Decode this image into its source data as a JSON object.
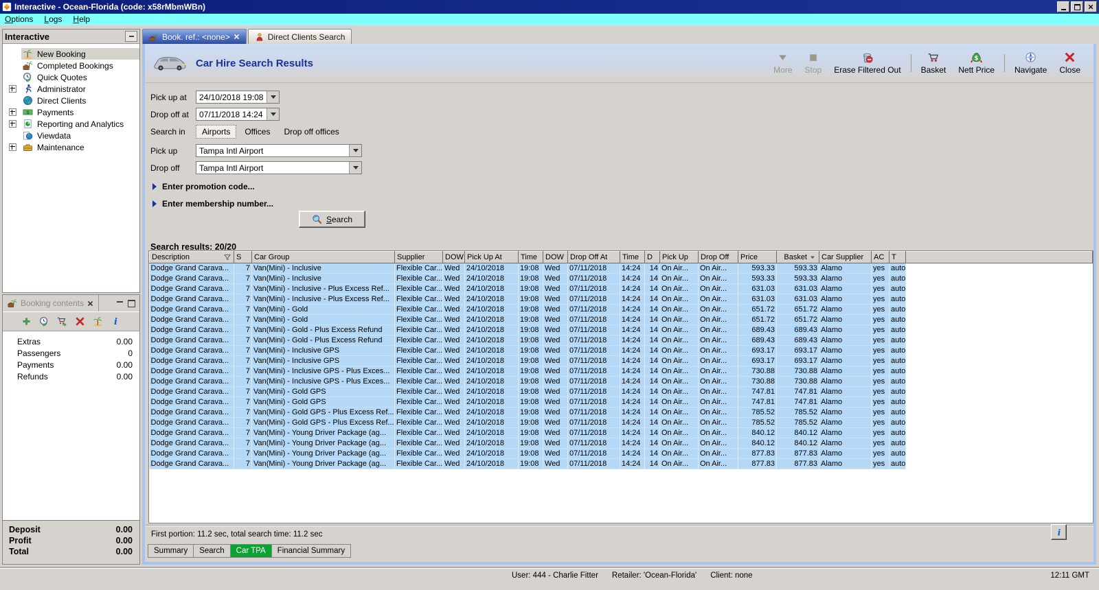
{
  "window": {
    "title": "Interactive - Ocean-Florida (code: x58rMbmWBn)",
    "menu": [
      {
        "label": "Options",
        "key": "O"
      },
      {
        "label": "Logs",
        "key": "L"
      },
      {
        "label": "Help",
        "key": "H"
      }
    ],
    "status": {
      "user": "User: 444 - Charlie Fitter",
      "retailer": "Retailer: 'Ocean-Florida'",
      "client": "Client: none",
      "time": "12:11 GMT"
    }
  },
  "sidebar": {
    "title": "Interactive",
    "items": [
      {
        "label": "New Booking",
        "icon": "palm",
        "expandable": false,
        "selected": true
      },
      {
        "label": "Completed Bookings",
        "icon": "case-palm",
        "expandable": false
      },
      {
        "label": "Quick Quotes",
        "icon": "quickquote",
        "expandable": false
      },
      {
        "label": "Administrator",
        "icon": "runner",
        "expandable": true
      },
      {
        "label": "Direct Clients",
        "icon": "globe",
        "expandable": false
      },
      {
        "label": "Payments",
        "icon": "cash",
        "expandable": true
      },
      {
        "label": "Reporting and Analytics",
        "icon": "report",
        "expandable": true
      },
      {
        "label": "Viewdata",
        "icon": "viewdata",
        "expandable": false
      },
      {
        "label": "Maintenance",
        "icon": "toolbox",
        "expandable": true
      }
    ]
  },
  "booking_contents": {
    "title": "Booking contents",
    "toolbar": [
      {
        "name": "add",
        "icon": "plus"
      },
      {
        "name": "quick-quote",
        "icon": "quickquote"
      },
      {
        "name": "move-to-basket",
        "icon": "cart-add"
      },
      {
        "name": "delete",
        "icon": "x",
        "red": true
      },
      {
        "name": "new-booking",
        "icon": "palm"
      },
      {
        "name": "info",
        "icon": "info"
      }
    ],
    "rows": [
      {
        "label": "Extras",
        "value": "0.00"
      },
      {
        "label": "Passengers",
        "value": "0"
      },
      {
        "label": "Payments",
        "value": "0.00"
      },
      {
        "label": "Refunds",
        "value": "0.00"
      }
    ],
    "totals": [
      {
        "label": "Deposit",
        "value": "0.00"
      },
      {
        "label": "Profit",
        "value": "0.00"
      },
      {
        "label": "Total",
        "value": "0.00"
      }
    ]
  },
  "main": {
    "tabs": [
      {
        "label": "Book. ref.: <none>",
        "active": true
      },
      {
        "label": "Direct Clients Search",
        "active": false
      }
    ],
    "header": {
      "title": "Car Hire Search Results"
    },
    "toolbar": [
      {
        "label": "More",
        "icon": "arrow-down",
        "disabled": true
      },
      {
        "label": "Stop",
        "icon": "stop",
        "disabled": true
      },
      {
        "label": "Erase Filtered Out",
        "icon": "erase"
      },
      {
        "sep": true
      },
      {
        "label": "Basket",
        "icon": "basket"
      },
      {
        "label": "Nett Price",
        "icon": "nett-price"
      },
      {
        "sep": true
      },
      {
        "label": "Navigate",
        "icon": "navigate"
      },
      {
        "label": "Close",
        "icon": "x",
        "red": true
      }
    ],
    "form": {
      "pick_up_at_label": "Pick up at",
      "pick_up_at_value": "24/10/2018 19:08",
      "drop_off_at_label": "Drop off at",
      "drop_off_at_value": "07/11/2018 14:24",
      "search_in_label": "Search in",
      "search_in_options": [
        "Airports",
        "Offices",
        "Drop off offices"
      ],
      "search_in_selected": "Airports",
      "pick_up_label": "Pick up",
      "pick_up_value": "Tampa Intl Airport",
      "drop_off_label": "Drop off",
      "drop_off_value": "Tampa Intl Airport",
      "promotion_expander": "Enter promotion code...",
      "membership_expander": "Enter membership number...",
      "search_button": "Search"
    },
    "results": {
      "summary": "Search results: 20/20",
      "columns": [
        {
          "label": "Description",
          "filter": true
        },
        {
          "label": "S"
        },
        {
          "label": "Car Group"
        },
        {
          "label": "Supplier"
        },
        {
          "label": "DOW"
        },
        {
          "label": "Pick Up At"
        },
        {
          "label": "Time"
        },
        {
          "label": "DOW"
        },
        {
          "label": "Drop Off At"
        },
        {
          "label": "Time"
        },
        {
          "label": "D"
        },
        {
          "label": "Pick Up"
        },
        {
          "label": "Drop Off"
        },
        {
          "label": "Price"
        },
        {
          "label": "Basket",
          "sort": "desc"
        },
        {
          "label": "Car Supplier"
        },
        {
          "label": "AC"
        },
        {
          "label": "T"
        }
      ],
      "rows": [
        [
          "Dodge Grand Carava...",
          "7",
          "Van(Mini) - Inclusive",
          "Flexible Car...",
          "Wed",
          "24/10/2018",
          "19:08",
          "Wed",
          "07/11/2018",
          "14:24",
          "14",
          "On Air...",
          "On Air...",
          "593.33",
          "593.33",
          "Alamo",
          "yes",
          "auto"
        ],
        [
          "Dodge Grand Carava...",
          "7",
          "Van(Mini) - Inclusive",
          "Flexible Car...",
          "Wed",
          "24/10/2018",
          "19:08",
          "Wed",
          "07/11/2018",
          "14:24",
          "14",
          "On Air...",
          "On Air...",
          "593.33",
          "593.33",
          "Alamo",
          "yes",
          "auto"
        ],
        [
          "Dodge Grand Carava...",
          "7",
          "Van(Mini) - Inclusive - Plus Excess Ref...",
          "Flexible Car...",
          "Wed",
          "24/10/2018",
          "19:08",
          "Wed",
          "07/11/2018",
          "14:24",
          "14",
          "On Air...",
          "On Air...",
          "631.03",
          "631.03",
          "Alamo",
          "yes",
          "auto"
        ],
        [
          "Dodge Grand Carava...",
          "7",
          "Van(Mini) - Inclusive - Plus Excess Ref...",
          "Flexible Car...",
          "Wed",
          "24/10/2018",
          "19:08",
          "Wed",
          "07/11/2018",
          "14:24",
          "14",
          "On Air...",
          "On Air...",
          "631.03",
          "631.03",
          "Alamo",
          "yes",
          "auto"
        ],
        [
          "Dodge Grand Carava...",
          "7",
          "Van(Mini) - Gold",
          "Flexible Car...",
          "Wed",
          "24/10/2018",
          "19:08",
          "Wed",
          "07/11/2018",
          "14:24",
          "14",
          "On Air...",
          "On Air...",
          "651.72",
          "651.72",
          "Alamo",
          "yes",
          "auto"
        ],
        [
          "Dodge Grand Carava...",
          "7",
          "Van(Mini) - Gold",
          "Flexible Car...",
          "Wed",
          "24/10/2018",
          "19:08",
          "Wed",
          "07/11/2018",
          "14:24",
          "14",
          "On Air...",
          "On Air...",
          "651.72",
          "651.72",
          "Alamo",
          "yes",
          "auto"
        ],
        [
          "Dodge Grand Carava...",
          "7",
          "Van(Mini) - Gold - Plus Excess Refund",
          "Flexible Car...",
          "Wed",
          "24/10/2018",
          "19:08",
          "Wed",
          "07/11/2018",
          "14:24",
          "14",
          "On Air...",
          "On Air...",
          "689.43",
          "689.43",
          "Alamo",
          "yes",
          "auto"
        ],
        [
          "Dodge Grand Carava...",
          "7",
          "Van(Mini) - Gold - Plus Excess Refund",
          "Flexible Car...",
          "Wed",
          "24/10/2018",
          "19:08",
          "Wed",
          "07/11/2018",
          "14:24",
          "14",
          "On Air...",
          "On Air...",
          "689.43",
          "689.43",
          "Alamo",
          "yes",
          "auto"
        ],
        [
          "Dodge Grand Carava...",
          "7",
          "Van(Mini) - Inclusive GPS",
          "Flexible Car...",
          "Wed",
          "24/10/2018",
          "19:08",
          "Wed",
          "07/11/2018",
          "14:24",
          "14",
          "On Air...",
          "On Air...",
          "693.17",
          "693.17",
          "Alamo",
          "yes",
          "auto"
        ],
        [
          "Dodge Grand Carava...",
          "7",
          "Van(Mini) - Inclusive GPS",
          "Flexible Car...",
          "Wed",
          "24/10/2018",
          "19:08",
          "Wed",
          "07/11/2018",
          "14:24",
          "14",
          "On Air...",
          "On Air...",
          "693.17",
          "693.17",
          "Alamo",
          "yes",
          "auto"
        ],
        [
          "Dodge Grand Carava...",
          "7",
          "Van(Mini) - Inclusive GPS - Plus Exces...",
          "Flexible Car...",
          "Wed",
          "24/10/2018",
          "19:08",
          "Wed",
          "07/11/2018",
          "14:24",
          "14",
          "On Air...",
          "On Air...",
          "730.88",
          "730.88",
          "Alamo",
          "yes",
          "auto"
        ],
        [
          "Dodge Grand Carava...",
          "7",
          "Van(Mini) - Inclusive GPS - Plus Exces...",
          "Flexible Car...",
          "Wed",
          "24/10/2018",
          "19:08",
          "Wed",
          "07/11/2018",
          "14:24",
          "14",
          "On Air...",
          "On Air...",
          "730.88",
          "730.88",
          "Alamo",
          "yes",
          "auto"
        ],
        [
          "Dodge Grand Carava...",
          "7",
          "Van(Mini) - Gold GPS",
          "Flexible Car...",
          "Wed",
          "24/10/2018",
          "19:08",
          "Wed",
          "07/11/2018",
          "14:24",
          "14",
          "On Air...",
          "On Air...",
          "747.81",
          "747.81",
          "Alamo",
          "yes",
          "auto"
        ],
        [
          "Dodge Grand Carava...",
          "7",
          "Van(Mini) - Gold GPS",
          "Flexible Car...",
          "Wed",
          "24/10/2018",
          "19:08",
          "Wed",
          "07/11/2018",
          "14:24",
          "14",
          "On Air...",
          "On Air...",
          "747.81",
          "747.81",
          "Alamo",
          "yes",
          "auto"
        ],
        [
          "Dodge Grand Carava...",
          "7",
          "Van(Mini) - Gold GPS - Plus Excess Ref...",
          "Flexible Car...",
          "Wed",
          "24/10/2018",
          "19:08",
          "Wed",
          "07/11/2018",
          "14:24",
          "14",
          "On Air...",
          "On Air...",
          "785.52",
          "785.52",
          "Alamo",
          "yes",
          "auto"
        ],
        [
          "Dodge Grand Carava...",
          "7",
          "Van(Mini) - Gold GPS - Plus Excess Ref...",
          "Flexible Car...",
          "Wed",
          "24/10/2018",
          "19:08",
          "Wed",
          "07/11/2018",
          "14:24",
          "14",
          "On Air...",
          "On Air...",
          "785.52",
          "785.52",
          "Alamo",
          "yes",
          "auto"
        ],
        [
          "Dodge Grand Carava...",
          "7",
          "Van(Mini) - Young Driver Package (ag...",
          "Flexible Car...",
          "Wed",
          "24/10/2018",
          "19:08",
          "Wed",
          "07/11/2018",
          "14:24",
          "14",
          "On Air...",
          "On Air...",
          "840.12",
          "840.12",
          "Alamo",
          "yes",
          "auto"
        ],
        [
          "Dodge Grand Carava...",
          "7",
          "Van(Mini) - Young Driver Package (ag...",
          "Flexible Car...",
          "Wed",
          "24/10/2018",
          "19:08",
          "Wed",
          "07/11/2018",
          "14:24",
          "14",
          "On Air...",
          "On Air...",
          "840.12",
          "840.12",
          "Alamo",
          "yes",
          "auto"
        ],
        [
          "Dodge Grand Carava...",
          "7",
          "Van(Mini) - Young Driver Package (ag...",
          "Flexible Car...",
          "Wed",
          "24/10/2018",
          "19:08",
          "Wed",
          "07/11/2018",
          "14:24",
          "14",
          "On Air...",
          "On Air...",
          "877.83",
          "877.83",
          "Alamo",
          "yes",
          "auto"
        ],
        [
          "Dodge Grand Carava...",
          "7",
          "Van(Mini) - Young Driver Package (ag...",
          "Flexible Car...",
          "Wed",
          "24/10/2018",
          "19:08",
          "Wed",
          "07/11/2018",
          "14:24",
          "14",
          "On Air...",
          "On Air...",
          "877.83",
          "877.83",
          "Alamo",
          "yes",
          "auto"
        ]
      ]
    },
    "footer_status": "First portion: 11.2 sec, total search time: 11.2 sec",
    "bottom_tabs": [
      {
        "label": "Summary"
      },
      {
        "label": "Search"
      },
      {
        "label": "Car TPA",
        "active": true
      },
      {
        "label": "Financial Summary"
      }
    ]
  },
  "colors": {
    "titlebar_navy": "#101f7c",
    "menubar_cyan": "#80ffff",
    "header_title_navy": "#16339c",
    "row_blue": "#b4d8f6",
    "active_bottom_tab_green": "#0ca133",
    "child_border_blue": "#a9c4ec"
  }
}
